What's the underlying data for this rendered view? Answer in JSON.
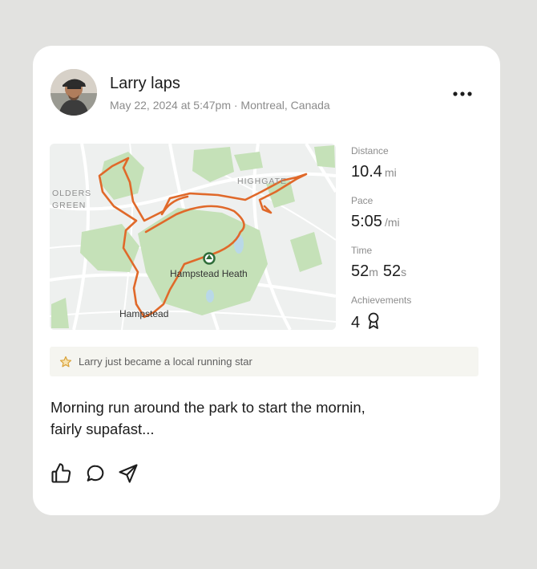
{
  "post": {
    "author_name": "Larry laps",
    "meta": "May 22, 2024 at 5:47pm · Montreal, Canada",
    "caption_line1": "Morning run around the park to start the mornin,",
    "caption_line2": "fairly supafast..."
  },
  "map": {
    "labels": {
      "olders": "OLDERS",
      "green": "GREEN",
      "highgate": "HIGHGATE",
      "hampstead_heath": "Hampstead Heath",
      "hampstead": "Hampstead"
    },
    "route_color": "#e0692a",
    "park_color": "#c5e1b8"
  },
  "stats": {
    "distance": {
      "label": "Distance",
      "value": "10.4",
      "unit": "mi"
    },
    "pace": {
      "label": "Pace",
      "value": "5:05",
      "unit": "/mi"
    },
    "time": {
      "label": "Time",
      "minutes": "52",
      "minutes_unit": "m",
      "seconds": "52",
      "seconds_unit": "s"
    },
    "achievements": {
      "label": "Achievements",
      "value": "4",
      "icon": "award-ribbon-icon"
    }
  },
  "banner": {
    "icon": "star-icon",
    "text": "Larry just became a local running star",
    "star_color": "#d9a23a"
  },
  "actions": {
    "like_icon": "thumbs-up-icon",
    "comment_icon": "comment-bubble-icon",
    "share_icon": "send-icon"
  }
}
